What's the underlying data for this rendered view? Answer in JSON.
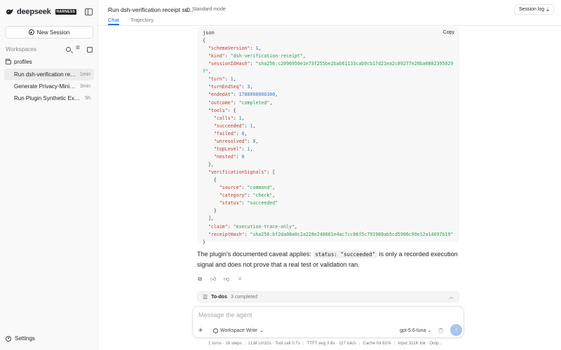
{
  "sidebar": {
    "brand": "deepseek",
    "badge": "HARNESS",
    "new_session_label": "New Session",
    "workspaces_title": "Workspaces",
    "folder": "profiles",
    "sessions": [
      {
        "title": "Run dsh-verification receipt smoke",
        "time": "1min",
        "active": true
      },
      {
        "title": "Generate Privacy-Minimal Receipt",
        "time": "3min",
        "active": false
      },
      {
        "title": "Run Plugin Synthetic Execution",
        "time": "5h",
        "active": false
      }
    ],
    "settings_label": "Settings"
  },
  "header": {
    "title": "Run dsh-verification receipt su...",
    "mode": "Standard mode",
    "tabs": [
      "Chat",
      "Trajectory"
    ],
    "session_log_label": "Session log"
  },
  "code": {
    "lang": "json",
    "copy_label": "Copy",
    "lines": [
      [
        [
          "p",
          "{"
        ]
      ],
      [
        [
          "p",
          "  "
        ],
        [
          "k",
          "\"schemaVersion\""
        ],
        [
          "p",
          ": "
        ],
        [
          "n",
          "1"
        ],
        [
          "p",
          ","
        ]
      ],
      [
        [
          "p",
          "  "
        ],
        [
          "k",
          "\"kind\""
        ],
        [
          "p",
          ": "
        ],
        [
          "s",
          "\"dsh-verification-receipt\""
        ],
        [
          "p",
          ","
        ]
      ],
      [
        [
          "p",
          "  "
        ],
        [
          "k",
          "\"sessionIdHash\""
        ],
        [
          "p",
          ": "
        ],
        [
          "s",
          "\"sha256:c2096950e1e73f255be2bab61133cab9cb17d21ea2c89277e20ba0802395029"
        ]
      ],
      [
        [
          "s",
          "f\""
        ],
        [
          "p",
          ","
        ]
      ],
      [
        [
          "p",
          "  "
        ],
        [
          "k",
          "\"turn\""
        ],
        [
          "p",
          ": "
        ],
        [
          "n",
          "1"
        ],
        [
          "p",
          ","
        ]
      ],
      [
        [
          "p",
          "  "
        ],
        [
          "k",
          "\"turnEndSeq\""
        ],
        [
          "p",
          ": "
        ],
        [
          "n",
          "3"
        ],
        [
          "p",
          ","
        ]
      ],
      [
        [
          "p",
          "  "
        ],
        [
          "k",
          "\"endedAt\""
        ],
        [
          "p",
          ": "
        ],
        [
          "n",
          "1780000000300"
        ],
        [
          "p",
          ","
        ]
      ],
      [
        [
          "p",
          "  "
        ],
        [
          "k",
          "\"outcome\""
        ],
        [
          "p",
          ": "
        ],
        [
          "s",
          "\"completed\""
        ],
        [
          "p",
          ","
        ]
      ],
      [
        [
          "p",
          "  "
        ],
        [
          "k",
          "\"tools\""
        ],
        [
          "p",
          ": {"
        ]
      ],
      [
        [
          "p",
          "    "
        ],
        [
          "k",
          "\"calls\""
        ],
        [
          "p",
          ": "
        ],
        [
          "n",
          "1"
        ],
        [
          "p",
          ","
        ]
      ],
      [
        [
          "p",
          "    "
        ],
        [
          "k",
          "\"succeeded\""
        ],
        [
          "p",
          ": "
        ],
        [
          "n",
          "1"
        ],
        [
          "p",
          ","
        ]
      ],
      [
        [
          "p",
          "    "
        ],
        [
          "k",
          "\"failed\""
        ],
        [
          "p",
          ": "
        ],
        [
          "n",
          "0"
        ],
        [
          "p",
          ","
        ]
      ],
      [
        [
          "p",
          "    "
        ],
        [
          "k",
          "\"unresolved\""
        ],
        [
          "p",
          ": "
        ],
        [
          "n",
          "0"
        ],
        [
          "p",
          ","
        ]
      ],
      [
        [
          "p",
          "    "
        ],
        [
          "k",
          "\"topLevel\""
        ],
        [
          "p",
          ": "
        ],
        [
          "n",
          "1"
        ],
        [
          "p",
          ","
        ]
      ],
      [
        [
          "p",
          "    "
        ],
        [
          "k",
          "\"nested\""
        ],
        [
          "p",
          ": "
        ],
        [
          "n",
          "0"
        ]
      ],
      [
        [
          "p",
          "  },"
        ]
      ],
      [
        [
          "p",
          "  "
        ],
        [
          "k",
          "\"verificationSignals\""
        ],
        [
          "p",
          ": ["
        ]
      ],
      [
        [
          "p",
          "    {"
        ]
      ],
      [
        [
          "p",
          "      "
        ],
        [
          "k",
          "\"source\""
        ],
        [
          "p",
          ": "
        ],
        [
          "s",
          "\"command\""
        ],
        [
          "p",
          ","
        ]
      ],
      [
        [
          "p",
          "      "
        ],
        [
          "k",
          "\"category\""
        ],
        [
          "p",
          ": "
        ],
        [
          "s",
          "\"check\""
        ],
        [
          "p",
          ","
        ]
      ],
      [
        [
          "p",
          "      "
        ],
        [
          "k",
          "\"status\""
        ],
        [
          "p",
          ": "
        ],
        [
          "s",
          "\"succeeded\""
        ]
      ],
      [
        [
          "p",
          "    }"
        ]
      ],
      [
        [
          "p",
          "  ],"
        ]
      ],
      [
        [
          "p",
          "  "
        ],
        [
          "k",
          "\"claim\""
        ],
        [
          "p",
          ": "
        ],
        [
          "s",
          "\"execution-trace-only\""
        ],
        [
          "p",
          ","
        ]
      ],
      [
        [
          "p",
          "  "
        ],
        [
          "k",
          "\"receiptHash\""
        ],
        [
          "p",
          ": "
        ],
        [
          "s",
          "\"sha256:bf2da08a0c2a228e248601e4ac7cc06f5c791980ab5cd5906c99e12a14697b19\""
        ]
      ],
      [
        [
          "p",
          "}"
        ]
      ]
    ]
  },
  "answer": {
    "prefix": "The plugin's documented caveat applies: ",
    "code": "status: \"succeeded\"",
    "suffix": " is only a recorded execution signal and does not prove that a real test or validation ran."
  },
  "todos": {
    "label": "To-dos",
    "count": "3 completed"
  },
  "composer": {
    "placeholder": "Message the agent",
    "workspace": "Workspace Write",
    "model": "gpt-5.6-luna"
  },
  "status": {
    "items": [
      "1 turns · 16 steps",
      "LLM 1m32s · Tool call 0.7s",
      "TTFT avg 3.8s · 117 tok/s",
      "Cache hit 81%",
      "Input 311K tok · Outp..."
    ]
  },
  "colors": {
    "accent": "#2b6fd6",
    "json_key": "#c0392b",
    "json_string": "#2e9e4f",
    "json_number": "#2f78c4",
    "send_button": "#a9c4ee"
  }
}
